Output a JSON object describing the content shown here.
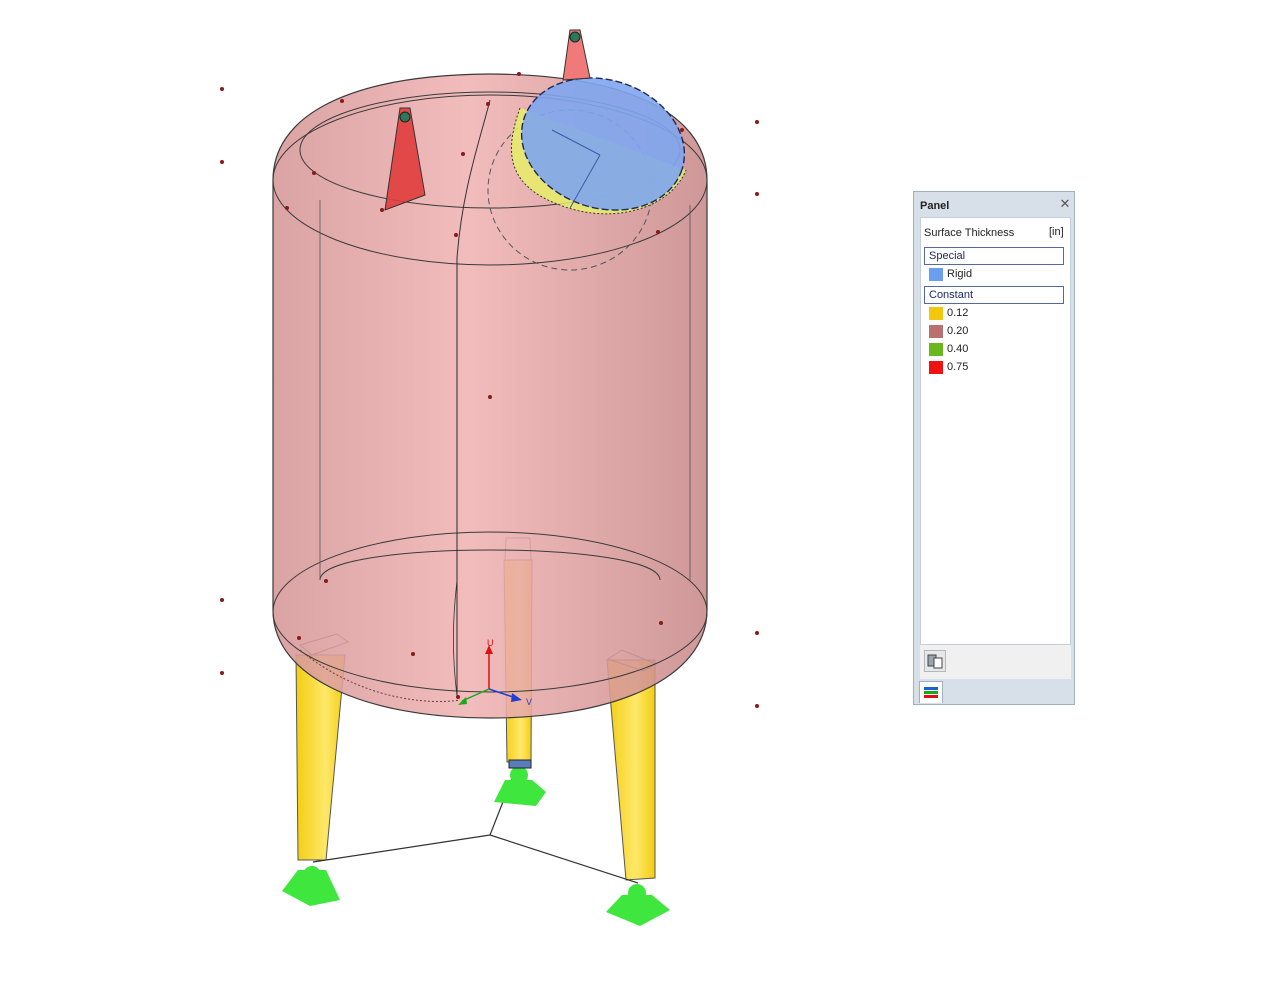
{
  "model": {
    "axes": {
      "u_label": "U",
      "v_label": "V"
    }
  },
  "panel": {
    "title": "Panel",
    "close_icon": "close-icon",
    "content_title": "Surface Thickness",
    "unit": "[in]",
    "groups": [
      {
        "label": "Special",
        "items": [
          {
            "label": "Rigid",
            "color": "#6a9ff0"
          }
        ]
      },
      {
        "label": "Constant",
        "items": [
          {
            "label": "0.12",
            "color": "#f2c80c"
          },
          {
            "label": "0.20",
            "color": "#b87070"
          },
          {
            "label": "0.40",
            "color": "#6ab819"
          },
          {
            "label": "0.75",
            "color": "#ee1212"
          }
        ]
      }
    ],
    "footer_button_icon": "print-icon",
    "tab_icon": "layers-icon"
  }
}
